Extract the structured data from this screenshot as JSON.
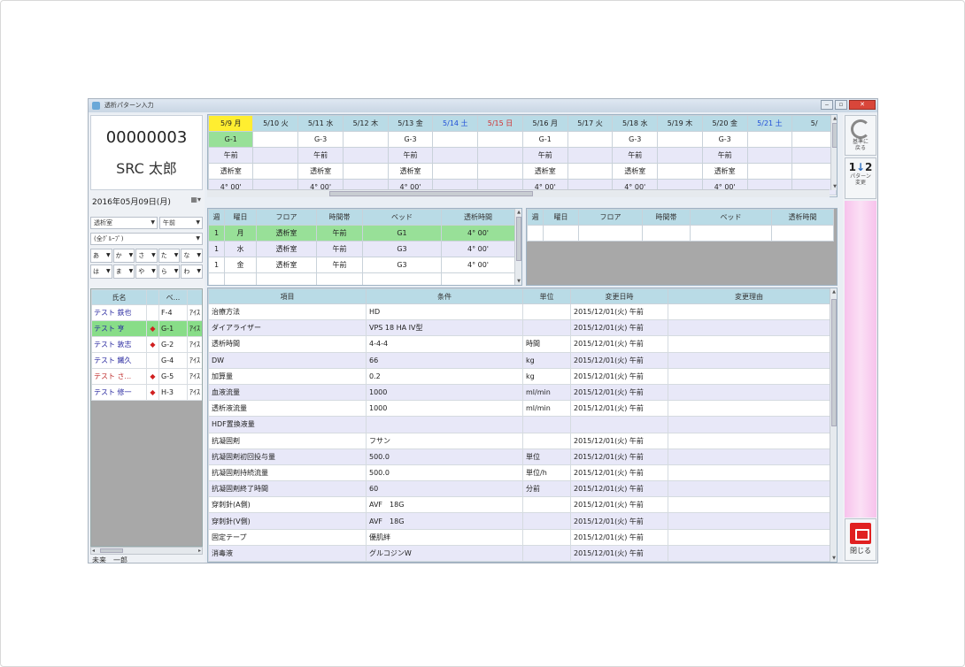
{
  "window": {
    "title": "透析パターン入力"
  },
  "patient": {
    "id": "00000003",
    "name": "SRC 太郎",
    "date": "2016年05月09日(月)",
    "date_icon": "calendar-icon"
  },
  "filters": {
    "room": "透析室",
    "time": "午前",
    "group": "(全ｸﾞﾙｰﾌﾟ)",
    "kana_row1": [
      "あ",
      "か",
      "さ",
      "た",
      "な"
    ],
    "kana_row2": [
      "は",
      "ま",
      "や",
      "ら",
      "わ"
    ]
  },
  "patient_list": {
    "columns": [
      "氏名",
      "ベ..."
    ],
    "rows": [
      {
        "name": "テスト 鉄也",
        "mark": "",
        "bed": "F-4",
        "extra": "ｱｲｽ"
      },
      {
        "name": "テスト 亨",
        "mark": "◆",
        "bed": "G-1",
        "extra": "ｱｲｽ"
      },
      {
        "name": "テスト 敦志",
        "mark": "◆",
        "bed": "G-2",
        "extra": "ｱｲｽ"
      },
      {
        "name": "テスト 鐵久",
        "mark": "",
        "bed": "G-4",
        "extra": "ｱｲｽ"
      },
      {
        "name": "テスト さ...",
        "mark": "◆",
        "bed": "G-5",
        "extra": "ｱｲｽ"
      },
      {
        "name": "テスト 修一",
        "mark": "◆",
        "bed": "H-3",
        "extra": "ｱｲｽ"
      }
    ],
    "footer": "未来　一郎"
  },
  "calendar": {
    "days": [
      "5/9 月",
      "5/10 火",
      "5/11 水",
      "5/12 木",
      "5/13 金",
      "5/14 土",
      "5/15 日",
      "5/16 月",
      "5/17 火",
      "5/18 水",
      "5/19 木",
      "5/20 金",
      "5/21 土",
      "5/"
    ],
    "bed": [
      "G-1",
      "",
      "G-3",
      "",
      "G-3",
      "",
      "",
      "G-1",
      "",
      "G-3",
      "",
      "G-3",
      "",
      ""
    ],
    "time": [
      "午前",
      "",
      "午前",
      "",
      "午前",
      "",
      "",
      "午前",
      "",
      "午前",
      "",
      "午前",
      "",
      ""
    ],
    "room": [
      "透析室",
      "",
      "透析室",
      "",
      "透析室",
      "",
      "",
      "透析室",
      "",
      "透析室",
      "",
      "透析室",
      "",
      ""
    ],
    "duration": [
      "4° 00'",
      "",
      "4° 00'",
      "",
      "4° 00'",
      "",
      "",
      "4° 00'",
      "",
      "4° 00'",
      "",
      "4° 00'",
      "",
      ""
    ]
  },
  "schedule_left": {
    "columns": [
      "週",
      "曜日",
      "フロア",
      "時間帯",
      "ベッド",
      "透析時間"
    ],
    "rows": [
      [
        "1",
        "月",
        "透析室",
        "午前",
        "G1",
        "4° 00'"
      ],
      [
        "1",
        "水",
        "透析室",
        "午前",
        "G3",
        "4° 00'"
      ],
      [
        "1",
        "金",
        "透析室",
        "午前",
        "G3",
        "4° 00'"
      ]
    ]
  },
  "schedule_right": {
    "columns": [
      "週",
      "曜日",
      "フロア",
      "時間帯",
      "ベッド",
      "透析時間"
    ]
  },
  "detail": {
    "columns": [
      "項目",
      "条件",
      "単位",
      "変更日時",
      "変更理由"
    ],
    "rows": [
      [
        "治療方法",
        "HD",
        "",
        "2015/12/01(火) 午前",
        ""
      ],
      [
        "ダイアライザー",
        "VPS 18 HA IV型",
        "",
        "2015/12/01(火) 午前",
        ""
      ],
      [
        "透析時間",
        "4-4-4",
        "時間",
        "2015/12/01(火) 午前",
        ""
      ],
      [
        "DW",
        "66",
        "kg",
        "2015/12/01(火) 午前",
        ""
      ],
      [
        "加算量",
        "0.2",
        "kg",
        "2015/12/01(火) 午前",
        ""
      ],
      [
        "血液流量",
        "1000",
        "ml/min",
        "2015/12/01(火) 午前",
        ""
      ],
      [
        "透析液流量",
        "1000",
        "ml/min",
        "2015/12/01(火) 午前",
        ""
      ],
      [
        "HDF置換液量",
        "",
        "",
        "",
        ""
      ],
      [
        "抗凝固剤",
        "フサン",
        "",
        "2015/12/01(火) 午前",
        ""
      ],
      [
        "抗凝固剤初回投与量",
        "500.0",
        "単位",
        "2015/12/01(火) 午前",
        ""
      ],
      [
        "抗凝固剤持続流量",
        "500.0",
        "単位/h",
        "2015/12/01(火) 午前",
        ""
      ],
      [
        "抗凝固剤終了時間",
        "60",
        "分前",
        "2015/12/01(火) 午前",
        ""
      ],
      [
        "穿刺針(A側)",
        "AVF　18G",
        "",
        "2015/12/01(火) 午前",
        ""
      ],
      [
        "穿刺針(V側)",
        "AVF　18G",
        "",
        "2015/12/01(火) 午前",
        ""
      ],
      [
        "固定テープ",
        "優肌絆",
        "",
        "2015/12/01(火) 午前",
        ""
      ],
      [
        "消毒液",
        "グルコジンW",
        "",
        "2015/12/01(火) 午前",
        ""
      ]
    ]
  },
  "toolbar": {
    "btn1_label": "基準に\n戻る",
    "btn2_label": "パターン\n変更",
    "btn2_icon": "1",
    "btn2_icon2": "2",
    "close_label": "閉じる"
  },
  "colors": {
    "header": "#b9dbe6",
    "selected": "#98e098",
    "today": "#ffee30",
    "pink": "#f7c2ec",
    "close": "#e02020"
  }
}
